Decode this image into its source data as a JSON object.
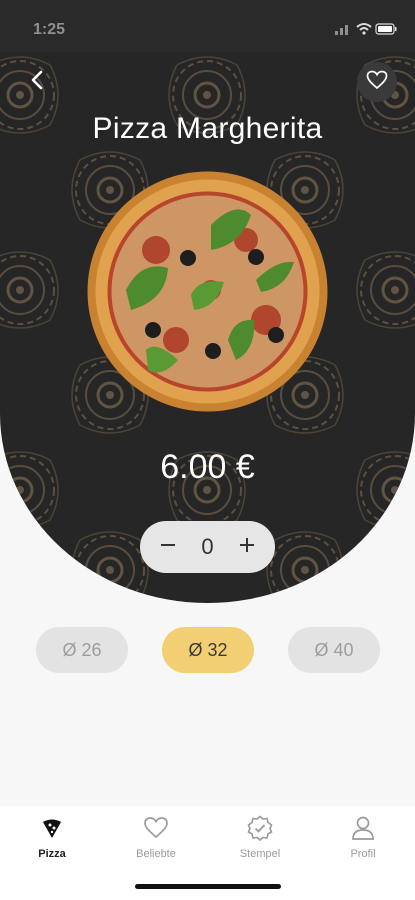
{
  "status": {
    "time": "1:25"
  },
  "header": {
    "title": "Pizza Margherita"
  },
  "product": {
    "price": "6.00 €",
    "quantity": "0"
  },
  "sizes": [
    {
      "label": "Ø 26",
      "active": false
    },
    {
      "label": "Ø 32",
      "active": true
    },
    {
      "label": "Ø 40",
      "active": false
    }
  ],
  "tabbar": {
    "items": [
      {
        "label": "Pizza",
        "icon": "pizza-icon",
        "active": true
      },
      {
        "label": "Beliebte",
        "icon": "heart-icon",
        "active": false
      },
      {
        "label": "Stempel",
        "icon": "badge-check-icon",
        "active": false
      },
      {
        "label": "Profil",
        "icon": "user-icon",
        "active": false
      }
    ]
  },
  "colors": {
    "hero_bg": "#262626",
    "ornament": "#8a7355",
    "accent": "#f3cf73",
    "chip_inactive": "#e3e3e3"
  }
}
